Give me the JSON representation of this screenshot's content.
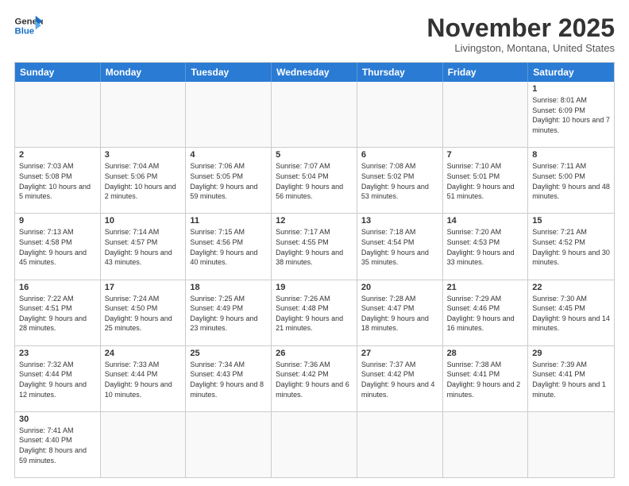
{
  "header": {
    "logo_general": "General",
    "logo_blue": "Blue",
    "month_title": "November 2025",
    "location": "Livingston, Montana, United States"
  },
  "calendar": {
    "days_of_week": [
      "Sunday",
      "Monday",
      "Tuesday",
      "Wednesday",
      "Thursday",
      "Friday",
      "Saturday"
    ],
    "weeks": [
      [
        {
          "day": "",
          "info": ""
        },
        {
          "day": "",
          "info": ""
        },
        {
          "day": "",
          "info": ""
        },
        {
          "day": "",
          "info": ""
        },
        {
          "day": "",
          "info": ""
        },
        {
          "day": "",
          "info": ""
        },
        {
          "day": "1",
          "info": "Sunrise: 8:01 AM\nSunset: 6:09 PM\nDaylight: 10 hours and 7 minutes."
        }
      ],
      [
        {
          "day": "2",
          "info": "Sunrise: 7:03 AM\nSunset: 5:08 PM\nDaylight: 10 hours and 5 minutes."
        },
        {
          "day": "3",
          "info": "Sunrise: 7:04 AM\nSunset: 5:06 PM\nDaylight: 10 hours and 2 minutes."
        },
        {
          "day": "4",
          "info": "Sunrise: 7:06 AM\nSunset: 5:05 PM\nDaylight: 9 hours and 59 minutes."
        },
        {
          "day": "5",
          "info": "Sunrise: 7:07 AM\nSunset: 5:04 PM\nDaylight: 9 hours and 56 minutes."
        },
        {
          "day": "6",
          "info": "Sunrise: 7:08 AM\nSunset: 5:02 PM\nDaylight: 9 hours and 53 minutes."
        },
        {
          "day": "7",
          "info": "Sunrise: 7:10 AM\nSunset: 5:01 PM\nDaylight: 9 hours and 51 minutes."
        },
        {
          "day": "8",
          "info": "Sunrise: 7:11 AM\nSunset: 5:00 PM\nDaylight: 9 hours and 48 minutes."
        }
      ],
      [
        {
          "day": "9",
          "info": "Sunrise: 7:13 AM\nSunset: 4:58 PM\nDaylight: 9 hours and 45 minutes."
        },
        {
          "day": "10",
          "info": "Sunrise: 7:14 AM\nSunset: 4:57 PM\nDaylight: 9 hours and 43 minutes."
        },
        {
          "day": "11",
          "info": "Sunrise: 7:15 AM\nSunset: 4:56 PM\nDaylight: 9 hours and 40 minutes."
        },
        {
          "day": "12",
          "info": "Sunrise: 7:17 AM\nSunset: 4:55 PM\nDaylight: 9 hours and 38 minutes."
        },
        {
          "day": "13",
          "info": "Sunrise: 7:18 AM\nSunset: 4:54 PM\nDaylight: 9 hours and 35 minutes."
        },
        {
          "day": "14",
          "info": "Sunrise: 7:20 AM\nSunset: 4:53 PM\nDaylight: 9 hours and 33 minutes."
        },
        {
          "day": "15",
          "info": "Sunrise: 7:21 AM\nSunset: 4:52 PM\nDaylight: 9 hours and 30 minutes."
        }
      ],
      [
        {
          "day": "16",
          "info": "Sunrise: 7:22 AM\nSunset: 4:51 PM\nDaylight: 9 hours and 28 minutes."
        },
        {
          "day": "17",
          "info": "Sunrise: 7:24 AM\nSunset: 4:50 PM\nDaylight: 9 hours and 25 minutes."
        },
        {
          "day": "18",
          "info": "Sunrise: 7:25 AM\nSunset: 4:49 PM\nDaylight: 9 hours and 23 minutes."
        },
        {
          "day": "19",
          "info": "Sunrise: 7:26 AM\nSunset: 4:48 PM\nDaylight: 9 hours and 21 minutes."
        },
        {
          "day": "20",
          "info": "Sunrise: 7:28 AM\nSunset: 4:47 PM\nDaylight: 9 hours and 18 minutes."
        },
        {
          "day": "21",
          "info": "Sunrise: 7:29 AM\nSunset: 4:46 PM\nDaylight: 9 hours and 16 minutes."
        },
        {
          "day": "22",
          "info": "Sunrise: 7:30 AM\nSunset: 4:45 PM\nDaylight: 9 hours and 14 minutes."
        }
      ],
      [
        {
          "day": "23",
          "info": "Sunrise: 7:32 AM\nSunset: 4:44 PM\nDaylight: 9 hours and 12 minutes."
        },
        {
          "day": "24",
          "info": "Sunrise: 7:33 AM\nSunset: 4:44 PM\nDaylight: 9 hours and 10 minutes."
        },
        {
          "day": "25",
          "info": "Sunrise: 7:34 AM\nSunset: 4:43 PM\nDaylight: 9 hours and 8 minutes."
        },
        {
          "day": "26",
          "info": "Sunrise: 7:36 AM\nSunset: 4:42 PM\nDaylight: 9 hours and 6 minutes."
        },
        {
          "day": "27",
          "info": "Sunrise: 7:37 AM\nSunset: 4:42 PM\nDaylight: 9 hours and 4 minutes."
        },
        {
          "day": "28",
          "info": "Sunrise: 7:38 AM\nSunset: 4:41 PM\nDaylight: 9 hours and 2 minutes."
        },
        {
          "day": "29",
          "info": "Sunrise: 7:39 AM\nSunset: 4:41 PM\nDaylight: 9 hours and 1 minute."
        }
      ],
      [
        {
          "day": "30",
          "info": "Sunrise: 7:41 AM\nSunset: 4:40 PM\nDaylight: 8 hours and 59 minutes."
        },
        {
          "day": "",
          "info": ""
        },
        {
          "day": "",
          "info": ""
        },
        {
          "day": "",
          "info": ""
        },
        {
          "day": "",
          "info": ""
        },
        {
          "day": "",
          "info": ""
        },
        {
          "day": "",
          "info": ""
        }
      ]
    ]
  }
}
